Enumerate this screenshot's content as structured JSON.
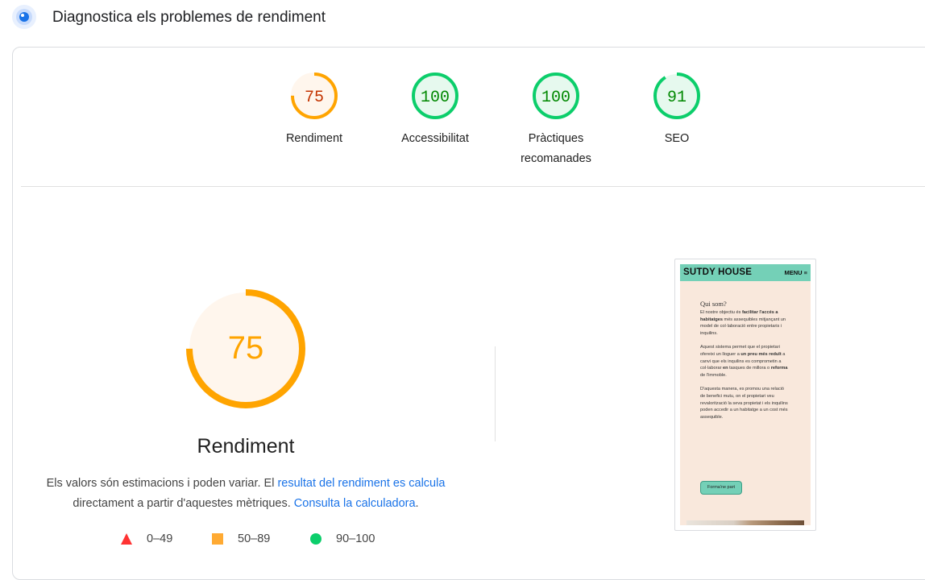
{
  "header": {
    "title": "Diagnostica els problemes de rendiment",
    "icon": "lighthouse-icon"
  },
  "scores": [
    {
      "value": 75,
      "label": "Rendiment",
      "status": "average"
    },
    {
      "value": 100,
      "label": "Accessibilitat",
      "status": "pass"
    },
    {
      "value": 100,
      "label": "Pràctiques recomanades",
      "status": "pass"
    },
    {
      "value": 91,
      "label": "SEO",
      "status": "pass"
    }
  ],
  "main": {
    "score": 75,
    "score_text": "75",
    "title": "Rendiment",
    "desc_part1": "Els valors són estimacions i poden variar. El ",
    "desc_link1": "resultat del rendiment es calcula",
    "desc_part2": " directament a partir d'aquestes mètriques. ",
    "desc_link2": "Consulta la calculadora",
    "desc_part3": "."
  },
  "legend": [
    {
      "range": "0–49",
      "shape": "triangle",
      "color": "#ff3333"
    },
    {
      "range": "50–89",
      "shape": "square",
      "color": "#ffaa33"
    },
    {
      "range": "90–100",
      "shape": "circle",
      "color": "#0cce6b"
    }
  ],
  "colors": {
    "average_fg": "#ffa400",
    "average_bg": "#fff6ed",
    "average_text": "#c33300",
    "pass_fg": "#0cce6b",
    "pass_bg": "#e6f9ee",
    "pass_text": "#008800",
    "big_text": "#ffa400"
  },
  "preview": {
    "logo": "SUTDY HOUSE",
    "menu": "MENU ≡",
    "heading": "Qui som?",
    "p1a": "El nostre objectiu és ",
    "p1b": "facilitar l'accés a habitatges",
    "p1c": " més assequibles mitjançant un model de col·laboració entre propietaris i inquilins.",
    "p2a": "Aquest sistema permet que el propietari ofereixi un lloguer a ",
    "p2b": "un preu més reduït",
    "p2c": " a canvi que els inquilins es comprometin a col·laborar ",
    "p2d": "en",
    "p2e": " tasques de millora o ",
    "p2f": "reforma",
    "p2g": " de l'immoble.",
    "p3a": "D'aquesta manera, es promou una relació de benefici mutu,",
    "p3b": " on el propietari veu revalorització la seva propietat i els inquilins poden accedir a un habitatge a un cost més assequible.",
    "button": "Forma'ne part"
  }
}
